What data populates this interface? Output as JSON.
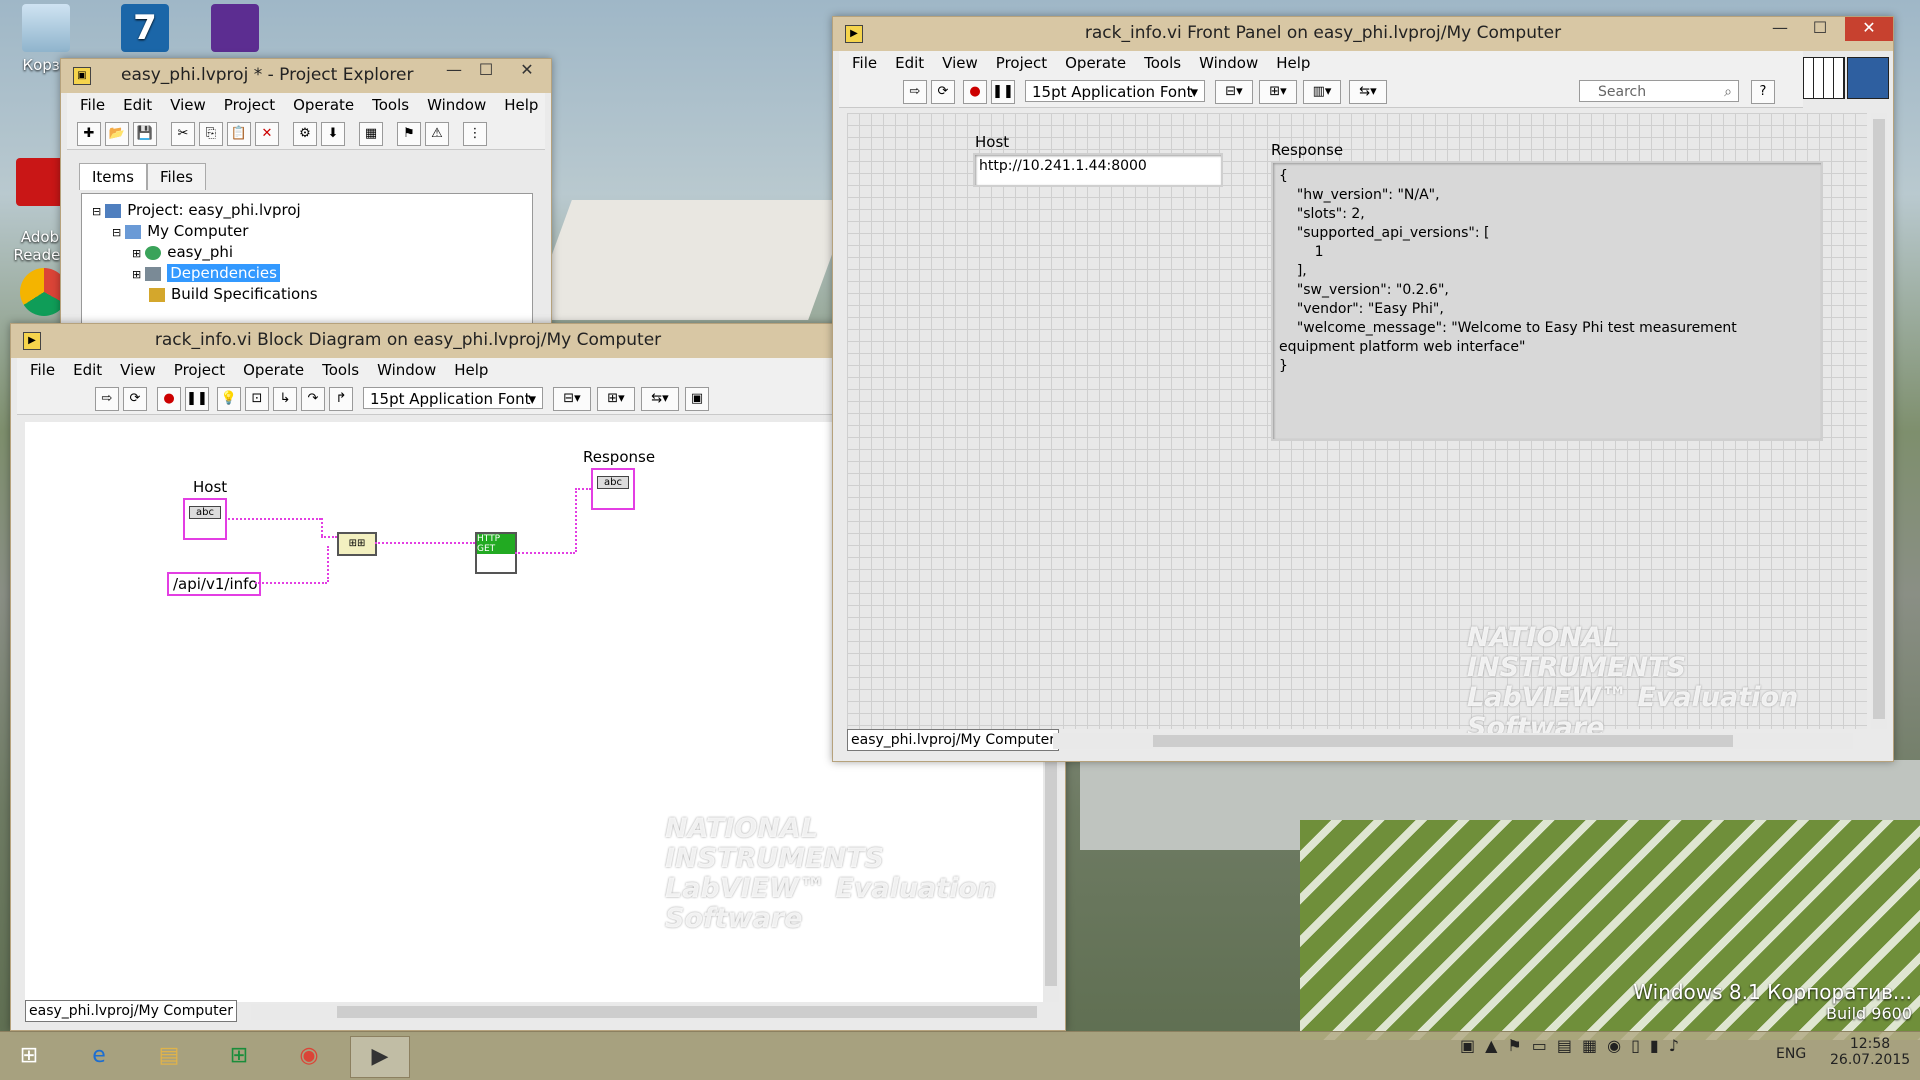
{
  "desktop": {
    "icons": [
      {
        "label": "Корзи",
        "icon": "recycle-bin-icon"
      },
      {
        "label": "Adob\nReader",
        "icon": "adobe-reader-icon"
      }
    ],
    "watermark_line1": "Windows 8.1 Корпоратив...",
    "watermark_line2": "Build 9600"
  },
  "project_explorer": {
    "title": "easy_phi.lvproj * - Project Explorer",
    "menu": [
      "File",
      "Edit",
      "View",
      "Project",
      "Operate",
      "Tools",
      "Window",
      "Help"
    ],
    "tabs": [
      "Items",
      "Files"
    ],
    "tree": [
      {
        "label": "Project: easy_phi.lvproj",
        "icon": "project-icon"
      },
      {
        "label": "My Computer",
        "icon": "computer-icon"
      },
      {
        "label": "easy_phi",
        "icon": "library-icon"
      },
      {
        "label": "Dependencies",
        "icon": "dependencies-icon",
        "selected": true
      },
      {
        "label": "Build Specifications",
        "icon": "build-spec-icon"
      }
    ]
  },
  "block_diagram": {
    "title": "rack_info.vi Block Diagram on easy_phi.lvproj/My Computer",
    "menu": [
      "File",
      "Edit",
      "View",
      "Project",
      "Operate",
      "Tools",
      "Window",
      "Help"
    ],
    "font": "15pt Application Font",
    "host_label": "Host",
    "host_terminal": "abc",
    "path_constant": "/api/v1/info",
    "http_node": "HTTP GET",
    "response_label": "Response",
    "response_terminal": "abc",
    "status_path": "easy_phi.lvproj/My Computer",
    "watermark": [
      "NATIONAL",
      "INSTRUMENTS",
      "LabVIEW™ Evaluation Software"
    ]
  },
  "front_panel": {
    "title": "rack_info.vi Front Panel on easy_phi.lvproj/My Computer",
    "menu": [
      "File",
      "Edit",
      "View",
      "Project",
      "Operate",
      "Tools",
      "Window",
      "Help"
    ],
    "font": "15pt Application Font",
    "search_placeholder": "Search",
    "host_label": "Host",
    "host_value": "http://10.241.1.44:8000",
    "response_label": "Response",
    "response_value": "{\n    \"hw_version\": \"N/A\",\n    \"slots\": 2,\n    \"supported_api_versions\": [\n        1\n    ],\n    \"sw_version\": \"0.2.6\",\n    \"vendor\": \"Easy Phi\",\n    \"welcome_message\": \"Welcome to Easy Phi test measurement equipment platform web interface\"\n}",
    "status_path": "easy_phi.lvproj/My Computer",
    "watermark": [
      "NATIONAL",
      "INSTRUMENTS",
      "LabVIEW™ Evaluation Software"
    ]
  },
  "taskbar": {
    "apps": [
      "start-button",
      "internet-explorer-icon",
      "file-explorer-icon",
      "store-icon",
      "chrome-icon",
      "labview-icon"
    ],
    "language": "ENG",
    "time": "12:58",
    "date": "26.07.2015"
  }
}
